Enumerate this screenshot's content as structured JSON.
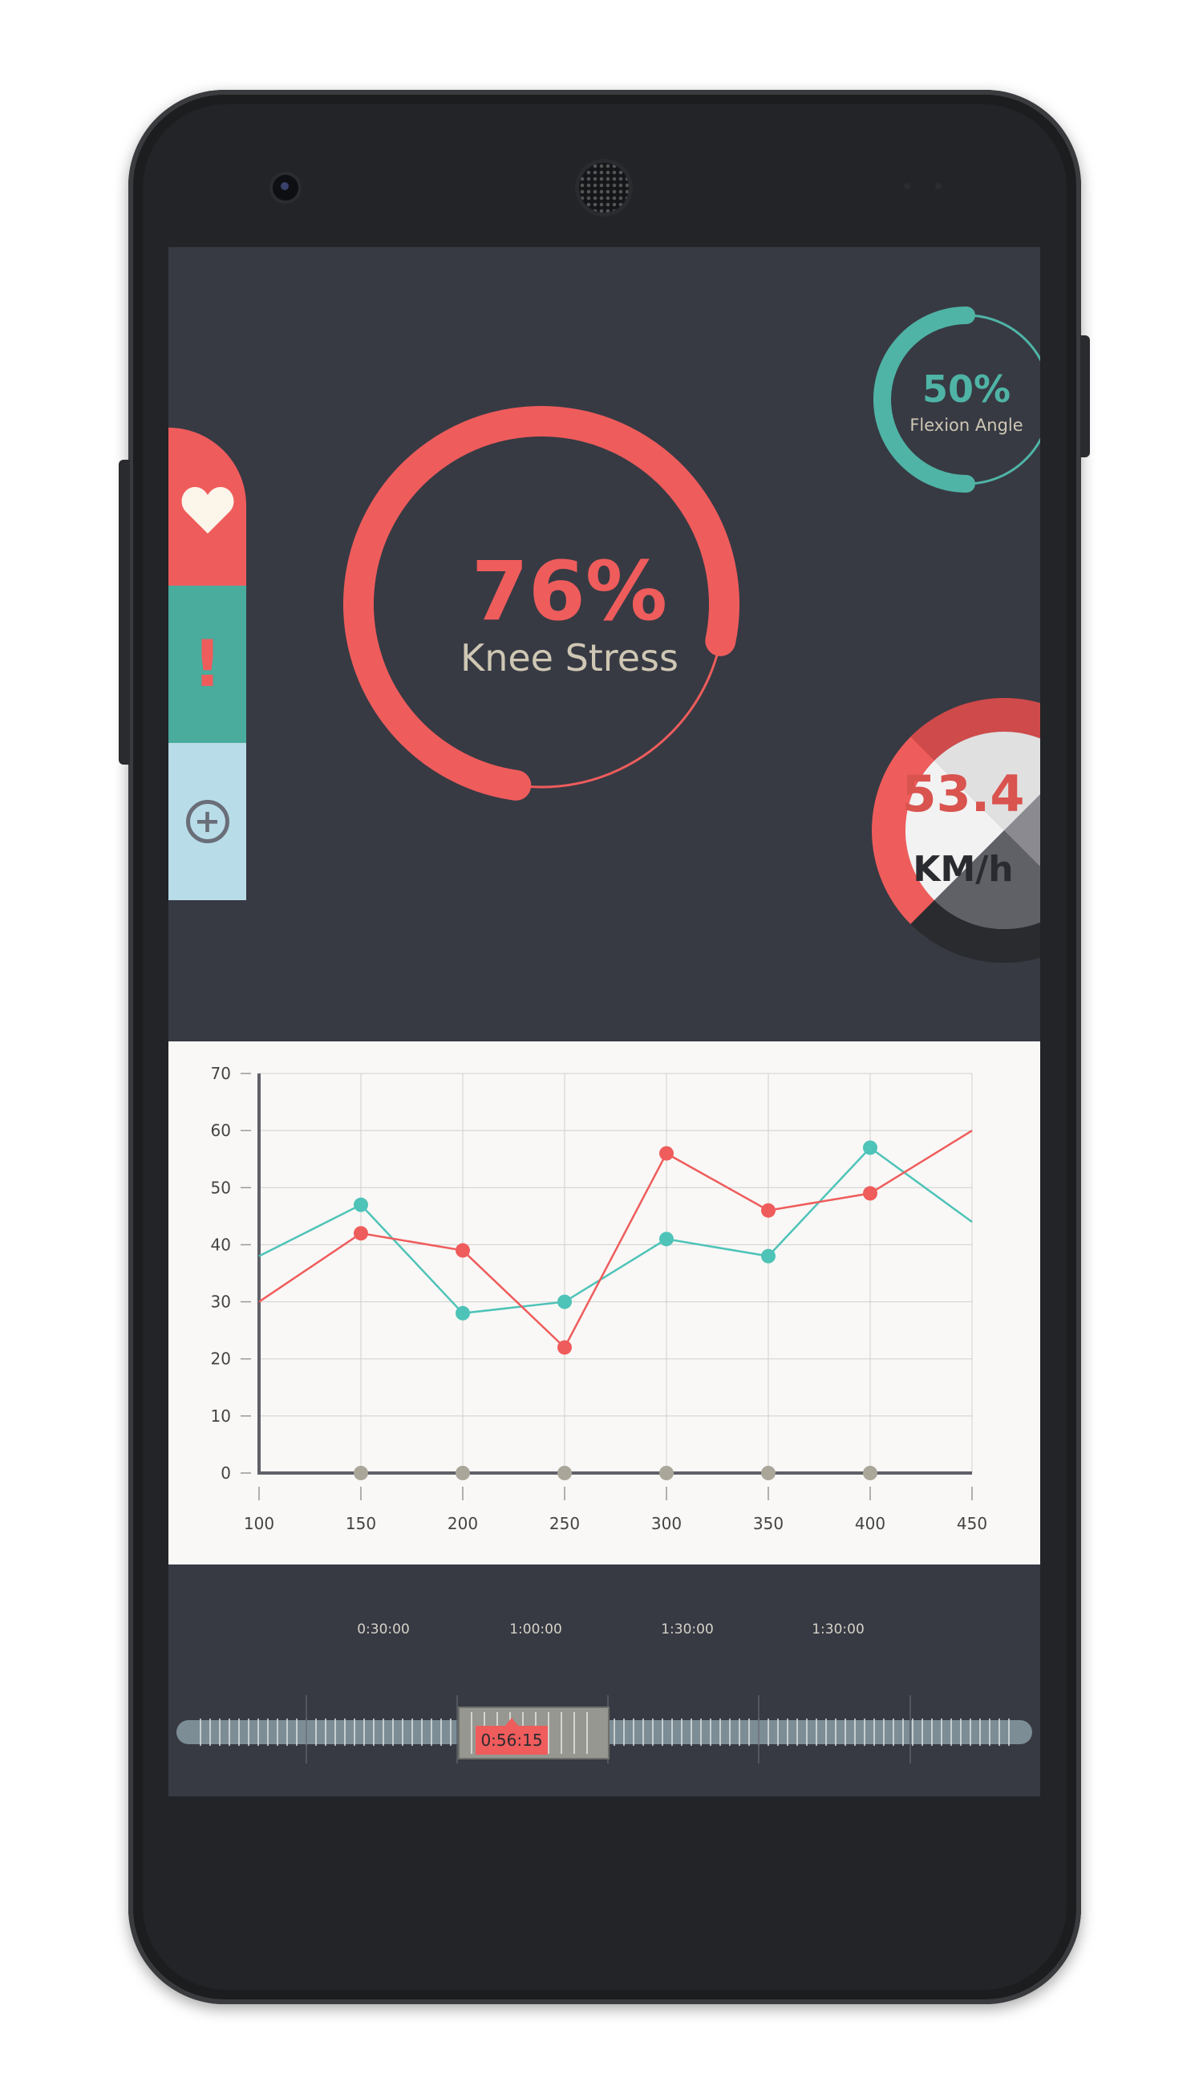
{
  "side_tabs": [
    {
      "name": "heart",
      "icon": "heart-icon",
      "color": "#ef5c5c"
    },
    {
      "name": "alert",
      "icon": "exclamation-icon",
      "label": "!",
      "color": "#49ac9d"
    },
    {
      "name": "add",
      "icon": "plus-circle-icon",
      "label": "+",
      "color": "#b8dde9"
    }
  ],
  "knee_stress": {
    "value": "76%",
    "label": "Knee Stress",
    "level": 0.76,
    "color": "#ef5c5c"
  },
  "flexion": {
    "value": "50%",
    "label": "Flexion Angle",
    "level": 0.5,
    "color": "#4fb4a6"
  },
  "speed": {
    "value": "53.4",
    "unit": "KM/h",
    "color": "#d9534f"
  },
  "chart_data": {
    "type": "line",
    "x": [
      100,
      150,
      200,
      250,
      300,
      350,
      400,
      450
    ],
    "ylim": [
      0,
      70
    ],
    "xlim": [
      100,
      450
    ],
    "y_ticks": [
      0,
      10,
      20,
      30,
      40,
      50,
      60,
      70
    ],
    "x_ticks": [
      100,
      150,
      200,
      250,
      300,
      350,
      400,
      450
    ],
    "grid": true,
    "series": [
      {
        "color": "#4ec3b8",
        "values": [
          38,
          47,
          28,
          30,
          41,
          38,
          57,
          44
        ]
      },
      {
        "color": "#ef5c5c",
        "values": [
          30,
          42,
          39,
          22,
          56,
          46,
          49,
          60
        ]
      }
    ]
  },
  "timeline": {
    "labels": [
      "0:30:00",
      "1:00:00",
      "1:30:00",
      "1:30:00"
    ],
    "current_time": "0:56:15"
  }
}
